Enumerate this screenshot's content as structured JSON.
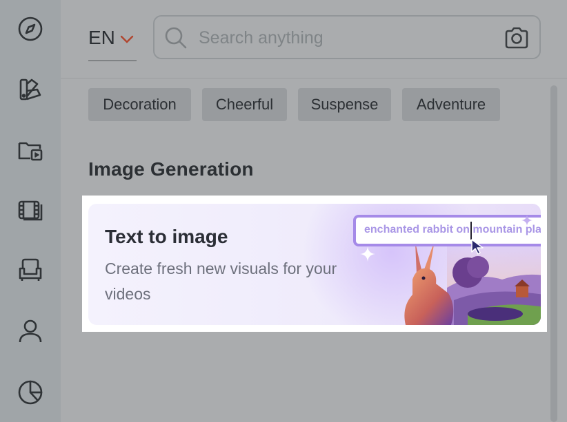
{
  "sidebar": {
    "items": [
      {
        "icon": "compass-icon",
        "name": "sidebar-item-explore"
      },
      {
        "icon": "palette-icon",
        "name": "sidebar-item-design"
      },
      {
        "icon": "video-folder-icon",
        "name": "sidebar-item-projects"
      },
      {
        "icon": "film-stack-icon",
        "name": "sidebar-item-media"
      },
      {
        "icon": "armchair-icon",
        "name": "sidebar-item-elements"
      },
      {
        "icon": "user-icon",
        "name": "sidebar-item-profile"
      },
      {
        "icon": "pie-chart-icon",
        "name": "sidebar-item-analytics"
      }
    ]
  },
  "header": {
    "language": "EN",
    "search_placeholder": "Search anything",
    "search_value": ""
  },
  "chips": [
    "Decoration",
    "Cheerful",
    "Suspense",
    "Adventure"
  ],
  "section": {
    "title": "Image Generation"
  },
  "card": {
    "title": "Text to image",
    "description": "Create fresh new visuals for your videos",
    "prompt_example": "enchanted rabbit on mountain plain"
  },
  "colors": {
    "accent": "#a58ae8",
    "chevron": "#b0452e",
    "overlay": "#aaacae"
  }
}
